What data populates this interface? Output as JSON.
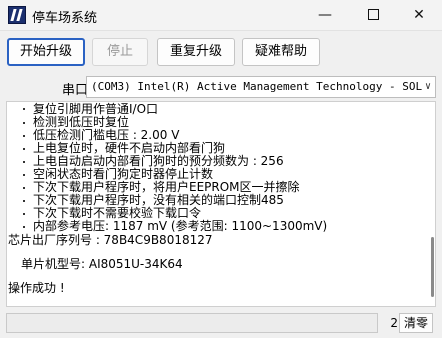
{
  "window": {
    "title": "停车场系统"
  },
  "titlebar_icons": {
    "minimize": "minimize-icon",
    "maximize": "maximize-icon",
    "close": "close-icon"
  },
  "toolbar": {
    "start_label": "开始升级",
    "stop_label": "停止",
    "restart_label": "重复升级",
    "help_label": "疑难帮助"
  },
  "port": {
    "label": "串口",
    "selected": "(COM3) Intel(R) Active Management Technology - SOL"
  },
  "log": {
    "lines": [
      "复位引脚用作普通I/O口",
      "检测到低压时复位",
      "低压检测门槛电压 : 2.00 V",
      "上电复位时，硬件不启动内部看门狗",
      "上电自动启动内部看门狗时的预分频数为 : 256",
      "空闲状态时看门狗定时器停止计数",
      "下次下载用户程序时，将用户EEPROM区一并擦除",
      "下次下载用户程序时，没有相关的端口控制485",
      "下次下载时不需要校验下载口令",
      "内部参考电压: 1187 mV (参考范围: 1100~1300mV)",
      "芯片出厂序列号 : 78B4C9B8018127",
      "单片机型号: AI8051U-34K64",
      "操作成功 !"
    ]
  },
  "status": {
    "count": "2",
    "clear_label": "清零"
  }
}
